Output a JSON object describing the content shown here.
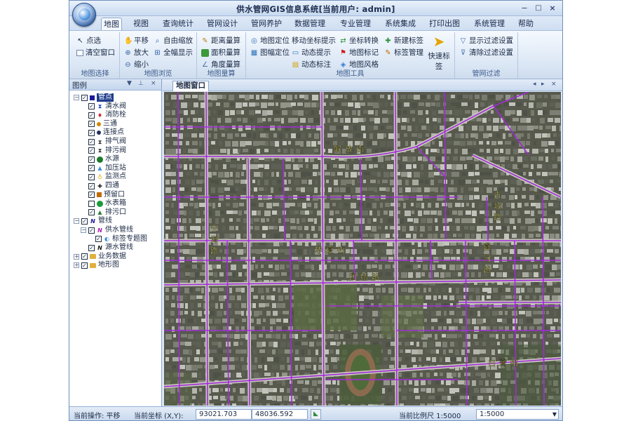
{
  "window": {
    "title": "供水管网GIS信息系统[当前用户: admin]",
    "min_glyph": "−",
    "max_glyph": "□",
    "close_glyph": "×"
  },
  "menu": {
    "tabs": [
      "地图",
      "视图",
      "查询统计",
      "管网设计",
      "管网养护",
      "数据管理",
      "专业管理",
      "系统集成",
      "打印出图",
      "系统管理",
      "帮助"
    ],
    "active_tab": "地图"
  },
  "ribbon": {
    "groups": [
      {
        "label": "地图选择",
        "buttons": [
          {
            "label": "点选",
            "icon": "pointer-icon"
          },
          {
            "label": "清空窗口",
            "icon": "clear-window-icon"
          }
        ]
      },
      {
        "label": "地图浏览",
        "buttons": [
          {
            "label": "平移",
            "icon": "hand-icon"
          },
          {
            "label": "自由缩放",
            "icon": "free-zoom-icon"
          },
          {
            "label": "放大",
            "icon": "zoom-in-icon"
          },
          {
            "label": "全幅显示",
            "icon": "full-extent-icon"
          },
          {
            "label": "缩小",
            "icon": "zoom-out-icon"
          }
        ]
      },
      {
        "label": "地图量算",
        "buttons": [
          {
            "label": "距离量算",
            "icon": "ruler-icon"
          },
          {
            "label": "面积量算",
            "icon": "area-icon"
          },
          {
            "label": "角度量算",
            "icon": "angle-icon"
          }
        ]
      },
      {
        "label": "地图工具",
        "buttons": [
          {
            "label": "地图定位",
            "icon": "locate-icon"
          },
          {
            "label": "图幅定位",
            "icon": "sheet-locate-icon"
          },
          {
            "label": "移动坐标提示",
            "icon": "move-coord-icon"
          },
          {
            "label": "动态提示",
            "icon": "dynamic-tip-icon"
          },
          {
            "label": "动态标注",
            "icon": "dynamic-label-icon"
          },
          {
            "label": "坐标转换",
            "icon": "coord-convert-icon"
          },
          {
            "label": "地图标记",
            "icon": "flag-icon"
          },
          {
            "label": "地图风格",
            "icon": "style-icon"
          },
          {
            "label": "新建标签",
            "icon": "new-tag-icon"
          },
          {
            "label": "标签管理",
            "icon": "tag-manage-icon"
          },
          {
            "label": "快速标签",
            "icon": "quick-tag-icon"
          }
        ]
      },
      {
        "label": "管网过滤",
        "buttons": [
          {
            "label": "显示过滤设置",
            "icon": "filter-icon"
          },
          {
            "label": "清除过滤设置",
            "icon": "clear-filter-icon"
          }
        ]
      }
    ]
  },
  "legend": {
    "title": "图例",
    "tree": [
      {
        "label": "管点",
        "level": 0,
        "expander": "−",
        "checked": true,
        "symbol": "square",
        "color": "#1a1a9c",
        "selected": true
      },
      {
        "label": "清水阀",
        "level": 1,
        "checked": true,
        "symbol": "valve",
        "color": "#1f46c8"
      },
      {
        "label": "消防栓",
        "level": 1,
        "checked": true,
        "symbol": "hydrant",
        "color": "#d11e1e"
      },
      {
        "label": "三通",
        "level": 1,
        "checked": true,
        "symbol": "dot",
        "color": "#d08a00"
      },
      {
        "label": "连接点",
        "level": 1,
        "checked": true,
        "symbol": "dot",
        "color": "#222f5e"
      },
      {
        "label": "排气阀",
        "level": 1,
        "checked": true,
        "symbol": "valve",
        "color": "#333333"
      },
      {
        "label": "排污阀",
        "level": 1,
        "checked": true,
        "symbol": "valve",
        "color": "#333333"
      },
      {
        "label": "水源",
        "level": 1,
        "checked": true,
        "symbol": "circle",
        "color": "#1c7a2b"
      },
      {
        "label": "加压站",
        "level": 1,
        "checked": true,
        "symbol": "triangle",
        "color": "#3a8de0"
      },
      {
        "label": "监测点",
        "level": 1,
        "checked": true,
        "symbol": "pin",
        "color": "#e6a800"
      },
      {
        "label": "四通",
        "level": 1,
        "checked": true,
        "symbol": "cross",
        "color": "#1a1a1a"
      },
      {
        "label": "预留口",
        "level": 1,
        "checked": true,
        "symbol": "square",
        "color": "#c06b00"
      },
      {
        "label": "水表箱",
        "level": 1,
        "checked": false,
        "symbol": "circle",
        "color": "#1c9a3b"
      },
      {
        "label": "排污口",
        "level": 1,
        "checked": true,
        "symbol": "triangle",
        "color": "#2e7d32"
      },
      {
        "label": "管线",
        "level": 0,
        "expander": "−",
        "checked": true,
        "symbol": "line",
        "color": "#1a1a9c"
      },
      {
        "label": "供水管线",
        "level": 1,
        "expander": "−",
        "checked": true,
        "symbol": "line",
        "color": "#b01ab0"
      },
      {
        "label": "标签专题图",
        "level": 2,
        "checked": true,
        "symbol": "tag",
        "color": "#2e8bd8"
      },
      {
        "label": "源水管线",
        "level": 1,
        "checked": true,
        "symbol": "line",
        "color": "#1a1a1a"
      },
      {
        "label": "业务数据",
        "level": 0,
        "expander": "+",
        "checked": true,
        "symbol": "folder",
        "color": "#e0b040"
      },
      {
        "label": "地形图",
        "level": 0,
        "expander": "+",
        "checked": true,
        "symbol": "folder",
        "color": "#e0b040"
      }
    ]
  },
  "map": {
    "tab_label": "地图窗口",
    "nav_left": "◂",
    "nav_right": "▸",
    "nav_close": "×",
    "pipe_color": "#a02cd8",
    "street_labels": [
      {
        "text": "解放街",
        "dir": "h"
      },
      {
        "text": "华夏街",
        "dir": "h"
      },
      {
        "text": "团结路",
        "dir": "h"
      },
      {
        "text": "白鹭街",
        "dir": "h"
      },
      {
        "text": "宁海路",
        "dir": "v"
      },
      {
        "text": "古城路",
        "dir": "v"
      },
      {
        "text": "夏河路",
        "dir": "v"
      }
    ]
  },
  "status": {
    "operation_label": "当前操作: 平移",
    "coord_label": "当前坐标 (X,Y):",
    "x_value": "93021.703",
    "y_value": "48036.592",
    "scale_label": "当前比例尺 1:5000",
    "scale_value": "1:5000",
    "scale_arrow": "▼"
  }
}
